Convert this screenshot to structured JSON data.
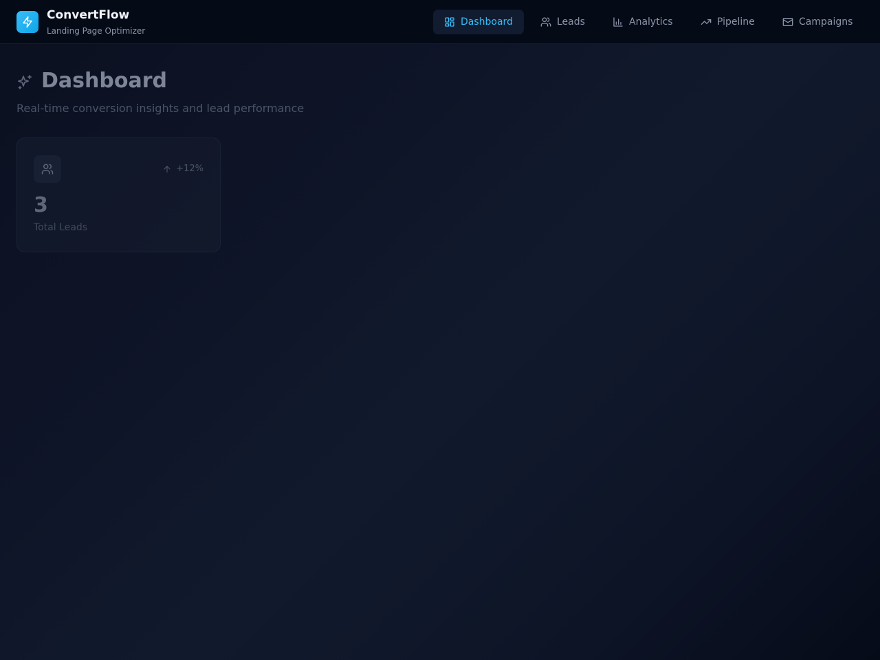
{
  "brand": {
    "name": "ConvertFlow",
    "tagline": "Landing Page Optimizer",
    "icon": "lightning-icon",
    "accent": "#38bdf8"
  },
  "nav": {
    "items": [
      {
        "label": "Dashboard",
        "icon": "dashboard-grid-icon",
        "active": true
      },
      {
        "label": "Leads",
        "icon": "users-icon",
        "active": false
      },
      {
        "label": "Analytics",
        "icon": "bar-chart-icon",
        "active": false
      },
      {
        "label": "Pipeline",
        "icon": "trending-up-icon",
        "active": false
      },
      {
        "label": "Campaigns",
        "icon": "mail-icon",
        "active": false
      }
    ]
  },
  "page": {
    "title": "Dashboard",
    "title_icon": "sparkles-icon",
    "subtitle": "Real-time conversion insights and lead performance"
  },
  "stats": [
    {
      "value": "3",
      "label": "Total Leads",
      "delta": "+12%",
      "icon": "users-icon",
      "delta_icon": "arrow-up-icon"
    }
  ]
}
